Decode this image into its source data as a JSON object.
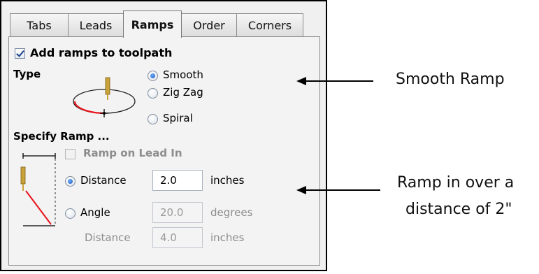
{
  "tabs": [
    {
      "label": "Tabs",
      "active": false
    },
    {
      "label": "Leads",
      "active": false
    },
    {
      "label": "Ramps",
      "active": true
    },
    {
      "label": "Order",
      "active": false
    },
    {
      "label": "Corners",
      "active": false
    }
  ],
  "ramps": {
    "add_ramps_label": "Add ramps to toolpath",
    "add_ramps_checked": true,
    "type_heading": "Type",
    "type_options": [
      {
        "label": "Smooth",
        "selected": true
      },
      {
        "label": "Zig Zag",
        "selected": false
      },
      {
        "label": "Spiral",
        "selected": false
      }
    ],
    "specify_heading": "Specify Ramp ...",
    "lead_in_label": "Ramp on Lead In",
    "lead_in_checked": false,
    "lead_in_enabled": false,
    "distance_option": {
      "label": "Distance",
      "selected": true,
      "value": "2.0",
      "unit": "inches"
    },
    "angle_option": {
      "label": "Angle",
      "selected": false,
      "value": "20.0",
      "unit": "degrees"
    },
    "angle_distance": {
      "label": "Distance",
      "value": "4.0",
      "unit": "inches"
    }
  },
  "annotations": {
    "smooth_callout": "Smooth Ramp",
    "distance_callout_line1": "Ramp in over a",
    "distance_callout_line2": "distance of 2\""
  },
  "colors": {
    "ramp_path": "#e8141c",
    "tool_gold": "#c9a23a",
    "radio_selected": "#1a55b8"
  }
}
